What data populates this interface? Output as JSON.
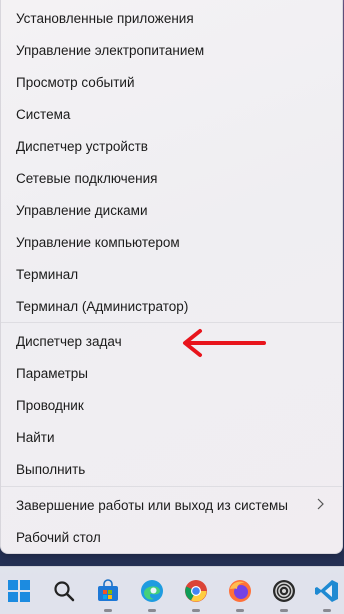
{
  "menu": {
    "items": [
      {
        "label": "Установленные приложения"
      },
      {
        "label": "Управление электропитанием"
      },
      {
        "label": "Просмотр событий"
      },
      {
        "label": "Система"
      },
      {
        "label": "Диспетчер устройств"
      },
      {
        "label": "Сетевые подключения"
      },
      {
        "label": "Управление дисками"
      },
      {
        "label": "Управление компьютером"
      },
      {
        "label": "Терминал"
      },
      {
        "label": "Терминал (Администратор)"
      },
      {
        "label": "Диспетчер задач"
      },
      {
        "label": "Параметры"
      },
      {
        "label": "Проводник"
      },
      {
        "label": "Найти"
      },
      {
        "label": "Выполнить"
      },
      {
        "label": "Завершение работы или выход из системы",
        "submenu": true
      },
      {
        "label": "Рабочий стол"
      }
    ],
    "highlight_color": "#e8141c"
  },
  "taskbar": {
    "icons": [
      "windows-start-icon",
      "search-icon",
      "store-icon",
      "edge-icon",
      "chrome-icon",
      "firefox-icon",
      "app-circle-icon",
      "vscode-icon"
    ]
  }
}
